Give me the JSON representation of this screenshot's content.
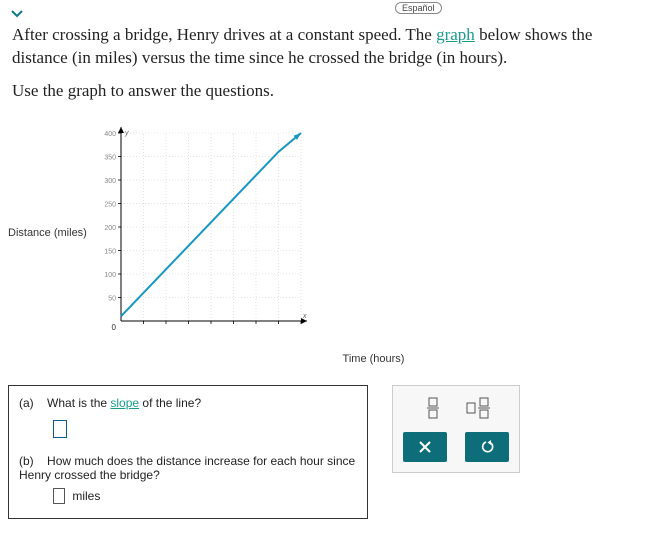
{
  "header": {
    "espanol_label": "Español"
  },
  "problem": {
    "part1": "After crossing a bridge, Henry drives at a constant speed. The ",
    "graph_word": "graph",
    "part2": " below shows the distance (in miles) versus the time since he crossed the bridge (in hours).",
    "part3": "Use the graph to answer the questions."
  },
  "axes": {
    "ylabel": "Distance (miles)",
    "xlabel": "Time (hours)"
  },
  "questions": {
    "a_label": "(a)",
    "a_text_pre": "What is the ",
    "a_slope_word": "slope",
    "a_text_post": " of the line?",
    "b_label": "(b)",
    "b_text": "How much does the distance increase for each hour since Henry crossed the bridge?",
    "b_unit": "miles"
  },
  "chart_data": {
    "type": "line",
    "title": "",
    "xlabel": "Time (hours)",
    "ylabel": "Distance (miles)",
    "xlim": [
      0,
      8
    ],
    "ylim": [
      0,
      400
    ],
    "xticks": [
      1,
      2,
      3,
      4,
      5,
      6,
      7,
      8
    ],
    "yticks": [
      50,
      100,
      150,
      200,
      250,
      300,
      350,
      400
    ],
    "series": [
      {
        "name": "distance",
        "x": [
          0,
          1,
          2,
          3,
          4,
          5,
          6,
          7,
          8
        ],
        "values": [
          10,
          60,
          110,
          160,
          210,
          260,
          310,
          360,
          410
        ]
      }
    ]
  }
}
